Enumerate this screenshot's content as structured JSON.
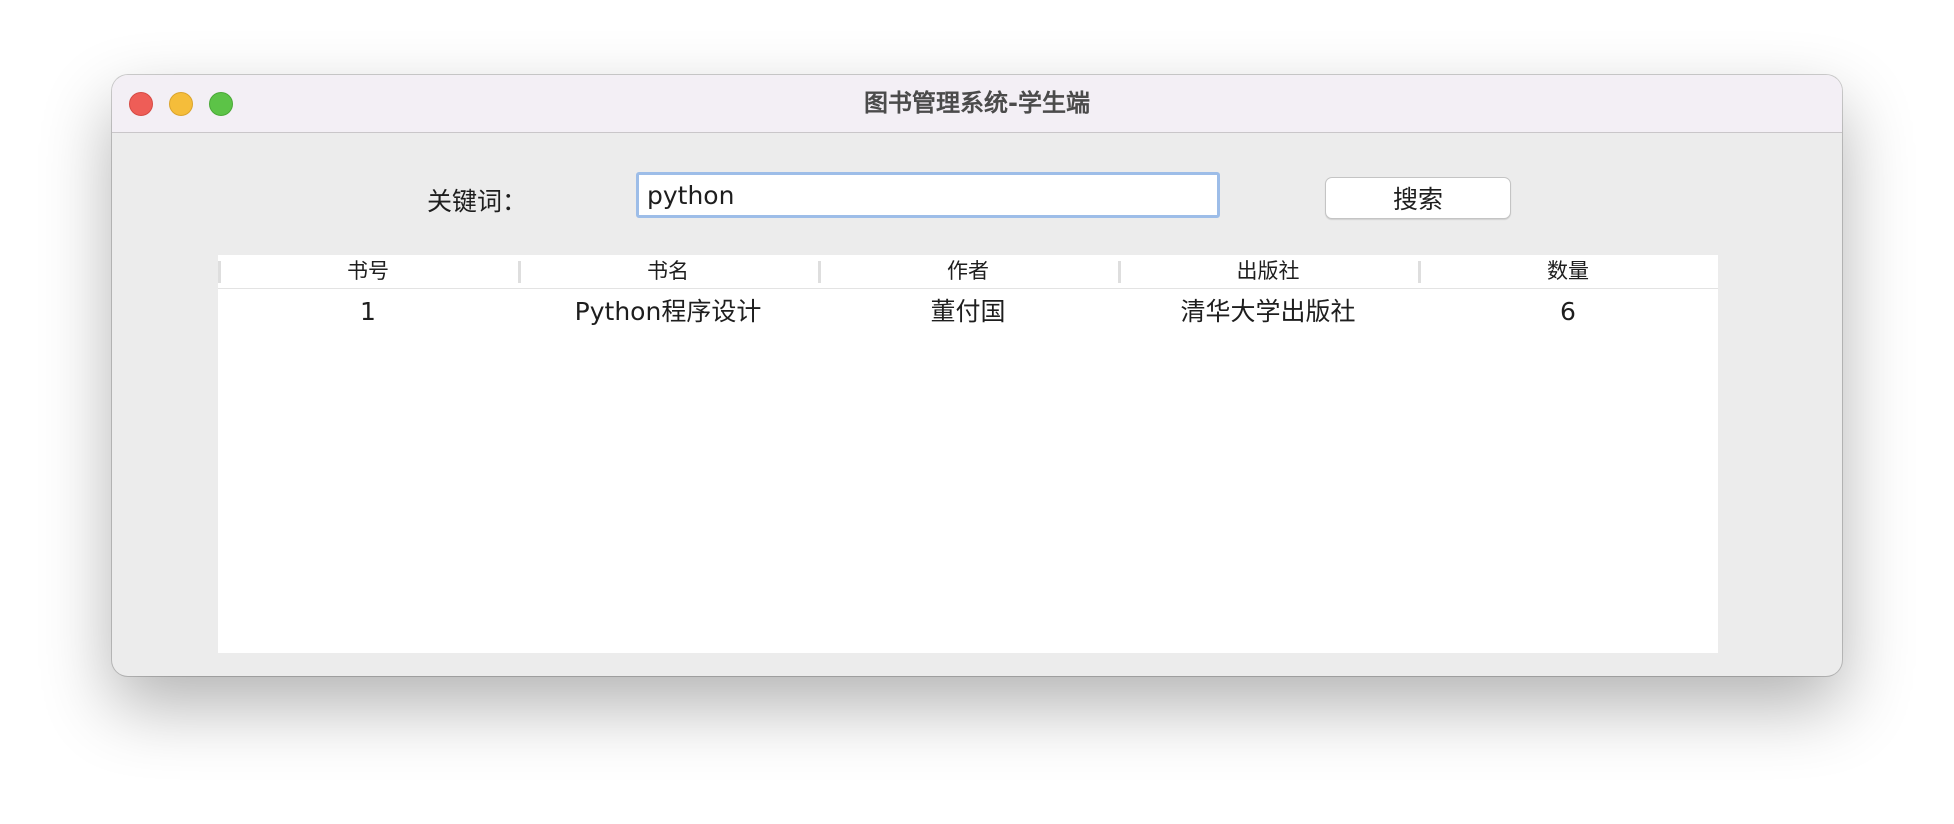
{
  "window": {
    "title": "图书管理系统-学生端"
  },
  "search": {
    "label": "关键词：",
    "value": "python",
    "button_label": "搜索"
  },
  "table": {
    "columns": [
      "书号",
      "书名",
      "作者",
      "出版社",
      "数量"
    ],
    "rows": [
      [
        "1",
        "Python程序设计",
        "董付国",
        "清华大学出版社",
        "6"
      ]
    ]
  },
  "colors": {
    "close": "#ee5d57",
    "minimize": "#f5bd3a",
    "maximize": "#5cc347",
    "input_focus_border": "#9dbde8"
  }
}
